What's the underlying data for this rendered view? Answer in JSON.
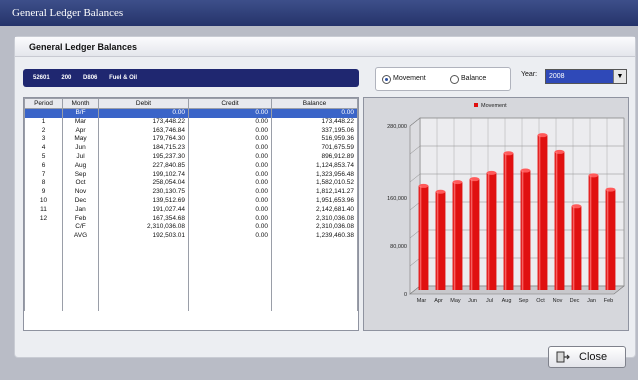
{
  "window": {
    "title": "General Ledger Balances"
  },
  "panel": {
    "title": "General Ledger Balances"
  },
  "account": {
    "code": "52601",
    "dept": "200",
    "sub": "D806",
    "name": "Fuel & Oil"
  },
  "view_mode": {
    "movement_label": "Movement",
    "balance_label": "Balance",
    "selected": "Movement"
  },
  "year": {
    "label": "Year:",
    "value": "2008"
  },
  "table": {
    "headers": [
      "Period",
      "Month",
      "Debit",
      "Credit",
      "Balance"
    ],
    "rows": [
      {
        "period": "",
        "month": "B/F",
        "debit": "0.00",
        "credit": "0.00",
        "balance": "0.00"
      },
      {
        "period": "1",
        "month": "Mar",
        "debit": "173,448.22",
        "credit": "0.00",
        "balance": "173,448.22"
      },
      {
        "period": "2",
        "month": "Apr",
        "debit": "163,746.84",
        "credit": "0.00",
        "balance": "337,195.06"
      },
      {
        "period": "3",
        "month": "May",
        "debit": "179,764.30",
        "credit": "0.00",
        "balance": "516,959.36"
      },
      {
        "period": "4",
        "month": "Jun",
        "debit": "184,715.23",
        "credit": "0.00",
        "balance": "701,675.59"
      },
      {
        "period": "5",
        "month": "Jul",
        "debit": "195,237.30",
        "credit": "0.00",
        "balance": "896,912.89"
      },
      {
        "period": "6",
        "month": "Aug",
        "debit": "227,840.85",
        "credit": "0.00",
        "balance": "1,124,853.74"
      },
      {
        "period": "7",
        "month": "Sep",
        "debit": "199,102.74",
        "credit": "0.00",
        "balance": "1,323,956.48"
      },
      {
        "period": "8",
        "month": "Oct",
        "debit": "258,054.04",
        "credit": "0.00",
        "balance": "1,582,010.52"
      },
      {
        "period": "9",
        "month": "Nov",
        "debit": "230,130.75",
        "credit": "0.00",
        "balance": "1,812,141.27"
      },
      {
        "period": "10",
        "month": "Dec",
        "debit": "139,512.69",
        "credit": "0.00",
        "balance": "1,951,653.96"
      },
      {
        "period": "11",
        "month": "Jan",
        "debit": "191,027.44",
        "credit": "0.00",
        "balance": "2,142,681.40"
      },
      {
        "period": "12",
        "month": "Feb",
        "debit": "167,354.68",
        "credit": "0.00",
        "balance": "2,310,036.08"
      },
      {
        "period": "",
        "month": "C/F",
        "debit": "2,310,036.08",
        "credit": "0.00",
        "balance": "2,310,036.08"
      },
      {
        "period": "",
        "month": "AVG",
        "debit": "192,503.01",
        "credit": "0.00",
        "balance": "1,239,460.38"
      }
    ]
  },
  "chart_data": {
    "type": "bar",
    "categories": [
      "Mar",
      "Apr",
      "May",
      "Jun",
      "Jul",
      "Aug",
      "Sep",
      "Oct",
      "Nov",
      "Dec",
      "Jan",
      "Feb"
    ],
    "series": [
      {
        "name": "Movement",
        "values": [
          173448.22,
          163746.84,
          179764.3,
          184715.23,
          195237.3,
          227840.85,
          199102.74,
          258054.04,
          230130.75,
          139512.69,
          191027.44,
          167354.68
        ]
      }
    ],
    "yticks": [
      "0",
      "80,000",
      "160,000",
      "280,000"
    ],
    "ylim": [
      0,
      280000
    ],
    "legend_position": "top",
    "grid": true,
    "bar_color": "#e01010"
  },
  "footer": {
    "close_label": "Close"
  },
  "colors": {
    "title_bar": "#2a3a78",
    "info_bar": "#1f2770",
    "selected_row": "#3a64c8",
    "bar": "#e01010"
  }
}
